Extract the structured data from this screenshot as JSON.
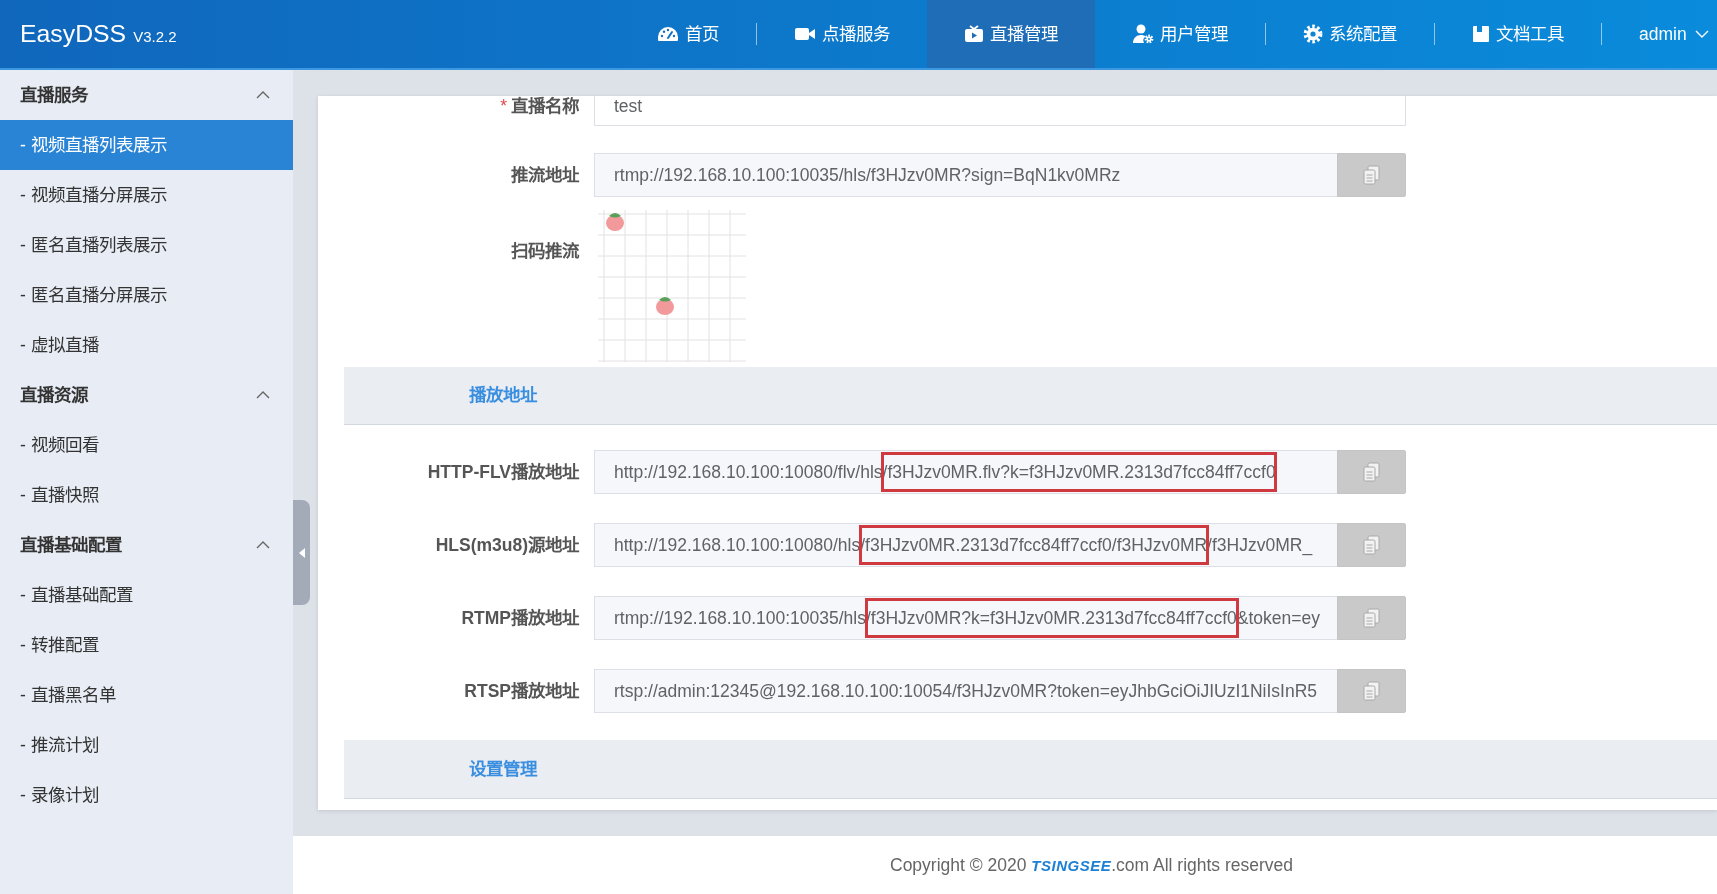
{
  "header": {
    "logo": "EasyDSS",
    "version": "V3.2.2",
    "nav": [
      {
        "label": "首页",
        "selected": false
      },
      {
        "label": "点播服务",
        "selected": false
      },
      {
        "label": "直播管理",
        "selected": true
      },
      {
        "label": "用户管理",
        "selected": false
      },
      {
        "label": "系统配置",
        "selected": false
      },
      {
        "label": "文档工具",
        "selected": false
      }
    ],
    "user": "admin"
  },
  "sidebar": {
    "sections": [
      {
        "title": "直播服务",
        "expanded": true,
        "items": [
          {
            "label": "- 视频直播列表展示",
            "selected": true
          },
          {
            "label": "- 视频直播分屏展示",
            "selected": false
          },
          {
            "label": "- 匿名直播列表展示",
            "selected": false
          },
          {
            "label": "- 匿名直播分屏展示",
            "selected": false
          },
          {
            "label": "- 虚拟直播",
            "selected": false
          }
        ]
      },
      {
        "title": "直播资源",
        "expanded": true,
        "items": [
          {
            "label": "- 视频回看",
            "selected": false
          },
          {
            "label": "- 直播快照",
            "selected": false
          }
        ]
      },
      {
        "title": "直播基础配置",
        "expanded": true,
        "items": [
          {
            "label": "- 直播基础配置",
            "selected": false
          },
          {
            "label": "- 转推配置",
            "selected": false
          },
          {
            "label": "- 直播黑名单",
            "selected": false
          },
          {
            "label": "- 推流计划",
            "selected": false
          },
          {
            "label": "- 录像计划",
            "selected": false
          }
        ]
      }
    ]
  },
  "form": {
    "rows": [
      {
        "kind": "text",
        "required_mark": "*",
        "label": "直播名称",
        "value": "test"
      },
      {
        "kind": "copy",
        "label": "推流地址",
        "value": "rtmp://192.168.10.100:10035/hls/f3HJzv0MR?sign=BqN1kv0MRz"
      },
      {
        "kind": "picture",
        "label": "扫码推流"
      }
    ],
    "sections": [
      {
        "title": "播放地址",
        "rows": [
          {
            "kind": "copy",
            "label": "HTTP-FLV播放地址",
            "segments": [
              {
                "text": "http://192.168.10.100:10080/flv/hls/",
                "highlighted": false
              },
              {
                "text": "f3HJzv0MR.flv?k=f3HJzv0MR.2313d7fcc84ff7ccf0",
                "highlighted": true
              }
            ]
          },
          {
            "kind": "copy",
            "label": "HLS(m3u8)源地址",
            "segments": [
              {
                "text": "http://192.168.10.100:10080/hls/",
                "highlighted": false
              },
              {
                "text": "f3HJzv0MR.2313d7fcc84ff7ccf0/f3HJzv0MR",
                "highlighted": true
              },
              {
                "text": "/f3HJzv0MR_",
                "highlighted": false
              }
            ]
          },
          {
            "kind": "copy",
            "label": "RTMP播放地址",
            "segments": [
              {
                "text": "rtmp://192.168.10.100:10035/hls/",
                "highlighted": false
              },
              {
                "text": "f3HJzv0MR?k=f3HJzv0MR.2313d7fcc84ff7ccf0",
                "highlighted": true
              },
              {
                "text": "&token=ey",
                "highlighted": false
              }
            ]
          },
          {
            "kind": "copy",
            "label": "RTSP播放地址",
            "value": "rtsp://admin:12345@192.168.10.100:10054/f3HJzv0MR?token=eyJhbGciOiJIUzI1NiIsInR5"
          }
        ]
      },
      {
        "title": "设置管理"
      }
    ]
  },
  "footer": {
    "text": "Copyright © 2020 **TSINGSEE**.com All rights reserved"
  }
}
